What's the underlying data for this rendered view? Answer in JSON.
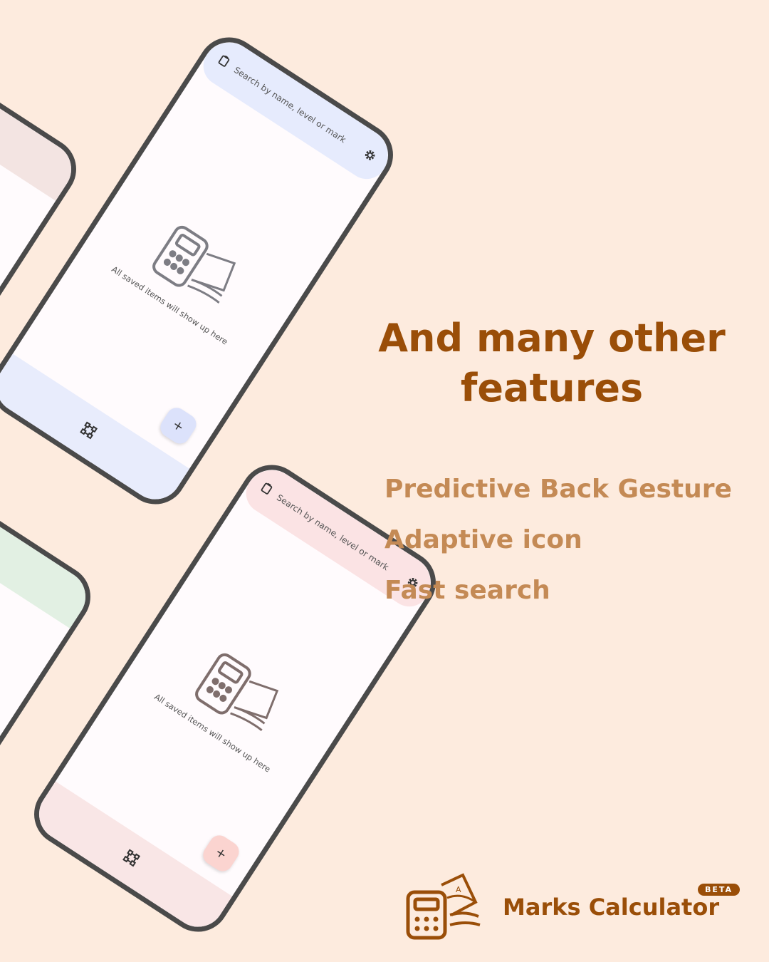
{
  "screens": [
    {
      "theme": "blue",
      "search_placeholder": "Search by name, level or mark",
      "empty_message": "All saved items will show up here",
      "fab_label": "+"
    },
    {
      "theme": "pink",
      "search_placeholder": "Search by name, level or mark",
      "empty_message": "All saved items will show up here",
      "fab_label": "+"
    }
  ],
  "headline": {
    "line1": "And many other",
    "line2": "features"
  },
  "features": [
    "Predictive Back Gesture",
    "Adaptive icon",
    "Fast search"
  ],
  "brand": {
    "name": "Marks Calculator",
    "badge": "BETA"
  },
  "colors": {
    "background": "#fdebde",
    "headline": "#9a4e08",
    "feature": "#c48a55",
    "blue_bar": "#e6ebfd",
    "pink_bar": "#fbe3e4",
    "phone_frame": "#4a4a4a"
  },
  "icons": {
    "search_leading": "clipboard-icon",
    "search_trailing": "gear-icon",
    "empty_state": "calculator-papers-icon",
    "nav": "nodes-icon",
    "fab": "plus-icon"
  }
}
